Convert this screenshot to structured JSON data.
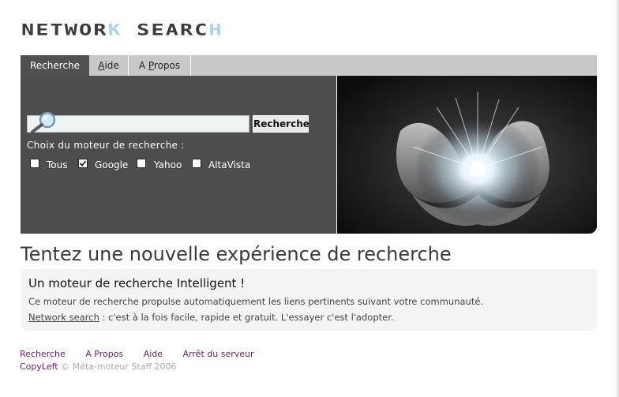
{
  "logo": {
    "main": "NETWOR",
    "accent1": "K",
    "mid": " SEARC",
    "accent2": "H"
  },
  "tabs": [
    {
      "label": "Recherche",
      "active": true
    },
    {
      "prefix": "",
      "underline": "A",
      "rest": "ide"
    },
    {
      "prefix": "A ",
      "underline": "P",
      "rest": "ropos"
    }
  ],
  "search": {
    "value": "",
    "button": "Recherche",
    "choice_label": "Choix du moteur de recherche :"
  },
  "engines": [
    {
      "label": "Tous",
      "checked": false
    },
    {
      "label": "Google",
      "checked": true
    },
    {
      "label": "Yahoo",
      "checked": false
    },
    {
      "label": "AltaVista",
      "checked": false
    }
  ],
  "headline": "Tentez une nouvelle expérience de recherche",
  "info": {
    "title": "Un moteur de recherche Intelligent !",
    "line1": "Ce moteur de recherche propulse automatiquement les liens pertinents suivant votre communauté.",
    "link": "Network search",
    "line2_rest": " : c'est à la fois facile, rapide et gratuit. L'essayer c'est l'adopter."
  },
  "footer": {
    "links": [
      "Recherche",
      "A Propos",
      "Aide",
      "Arrêt du serveur"
    ],
    "copyleft": "CopyLeft",
    "copy_rest": " © Méta-moteur Staff 2006"
  },
  "colors": {
    "panel": "#4d4d4d",
    "tabbar": "#c8c8c8",
    "logo_accent": "#a9d6ee",
    "link": "#6a1d6a"
  }
}
